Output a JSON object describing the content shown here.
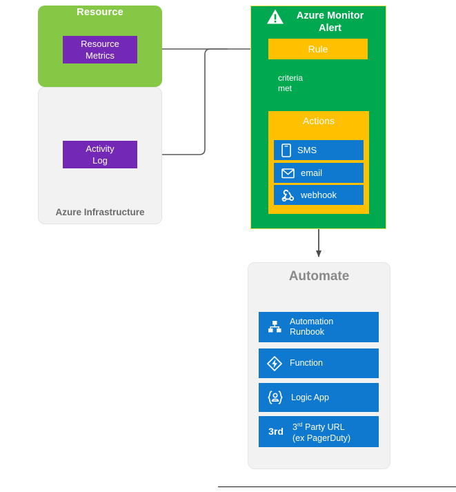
{
  "resource": {
    "title": "Resource",
    "metrics_label": "Resource\nMetrics",
    "metrics_line1": "Resource",
    "metrics_line2": "Metrics"
  },
  "infrastructure": {
    "title": "Azure Infrastructure",
    "activity_line1": "Activity",
    "activity_line2": "Log"
  },
  "alert": {
    "title": "Azure Monitor Alert",
    "icon": "warning-triangle-icon",
    "rule_label": "Rule",
    "criteria_line1": "criteria",
    "criteria_line2": "met",
    "criteria_icon": "checkmark-icon",
    "actions_title": "Actions",
    "actions": [
      {
        "label": "SMS",
        "icon": "phone-icon"
      },
      {
        "label": "email",
        "icon": "envelope-icon"
      },
      {
        "label": "webhook",
        "icon": "webhook-icon"
      }
    ]
  },
  "automate": {
    "title": "Automate",
    "items": [
      {
        "line1": "Automation",
        "line2": "Runbook",
        "icon": "hierarchy-icon",
        "badge": ""
      },
      {
        "line1": "Function",
        "line2": "",
        "icon": "lightning-bolt-icon",
        "badge": ""
      },
      {
        "line1": "Logic App",
        "line2": "",
        "icon": "logic-app-icon",
        "badge": ""
      },
      {
        "line1": "3rd Party URL",
        "line2": "(ex PagerDuty)",
        "icon": "third-party-badge-icon",
        "badge": "3rd"
      }
    ]
  },
  "colors": {
    "resource_green": "#86c845",
    "purple": "#7329b5",
    "alert_green": "#00a94f",
    "amber": "#ffc000",
    "azure_blue": "#0f79d0",
    "panel_grey": "#f2f2f2",
    "connector": "#5a5a5a"
  }
}
